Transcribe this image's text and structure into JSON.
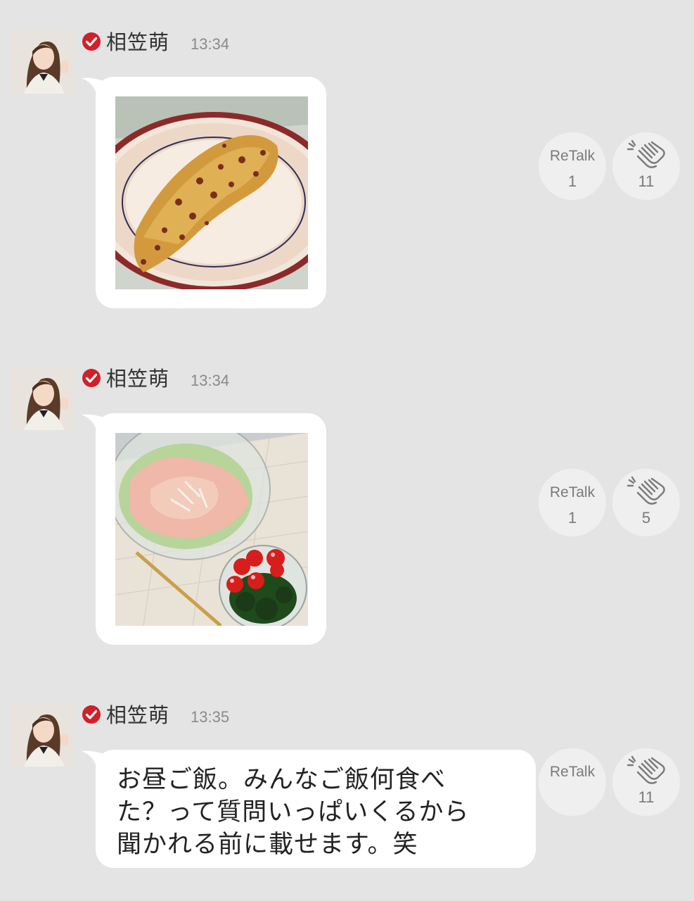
{
  "posts": [
    {
      "author": "相笠萌",
      "time": "13:34",
      "type": "image",
      "image": "omelette-photo",
      "retalk_label": "ReTalk",
      "retalk_count": "1",
      "clap_count": "11"
    },
    {
      "author": "相笠萌",
      "time": "13:34",
      "type": "image",
      "image": "salad-photo",
      "retalk_label": "ReTalk",
      "retalk_count": "1",
      "clap_count": "5"
    },
    {
      "author": "相笠萌",
      "time": "13:35",
      "type": "text",
      "text_lines": [
        "お昼ご飯。みんなご飯何食べ",
        "た？って質問いっぱいくるから",
        "聞かれる前に載せます。笑"
      ],
      "retalk_label": "ReTalk",
      "clap_count": "11"
    }
  ],
  "colors": {
    "verified": "#d0202a",
    "background": "#e4e4e4",
    "bubble": "#ffffff"
  },
  "icons": {
    "verified": "check-circle-icon",
    "clap": "clap-icon"
  }
}
